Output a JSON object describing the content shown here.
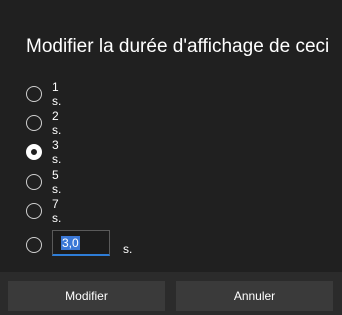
{
  "dialog": {
    "title": "Modifier la durée d'affichage de ceci"
  },
  "options": [
    {
      "label": "1 s.",
      "checked": false
    },
    {
      "label": "2 s.",
      "checked": false
    },
    {
      "label": "3 s.",
      "checked": true
    },
    {
      "label": "5 s.",
      "checked": false
    },
    {
      "label": "7 s.",
      "checked": false
    }
  ],
  "custom": {
    "value": "3,0",
    "unit": "s."
  },
  "buttons": {
    "confirm": "Modifier",
    "cancel": "Annuler"
  },
  "colors": {
    "background": "#202020",
    "footer": "#2b2b2b",
    "accent": "#2e7dd7"
  }
}
